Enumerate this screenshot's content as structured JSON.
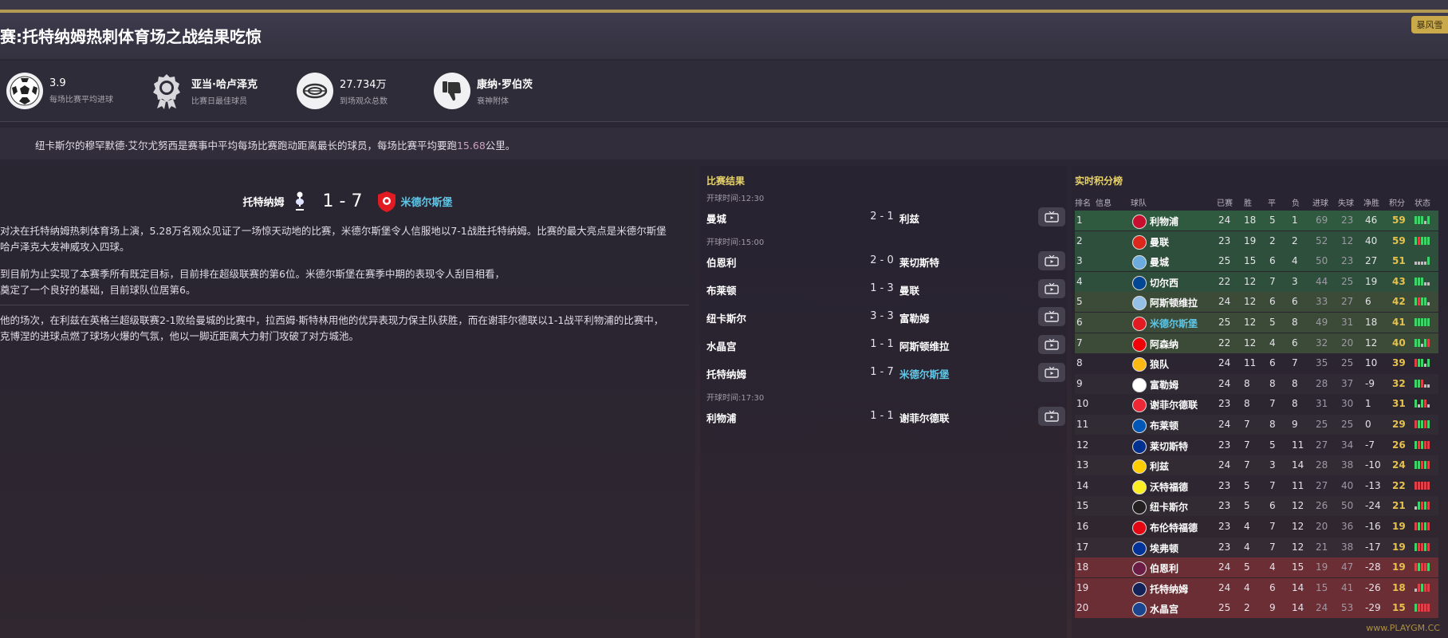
{
  "header": {
    "title": "赛:托特纳姆热刺体育场之战结果吃惊",
    "right_tag": "暴风雪"
  },
  "stats": [
    {
      "icon": "football-icon",
      "value": "3.9",
      "label": "每场比赛平均进球"
    },
    {
      "icon": "medal-icon",
      "value": "亚当·哈卢泽克",
      "label": "比赛日最佳球员"
    },
    {
      "icon": "stadium-icon",
      "value": "27.734万",
      "label": "到场观众总数"
    },
    {
      "icon": "thumbs-down-icon",
      "value": "康纳·罗伯茨",
      "label": "衰神附体"
    }
  ],
  "notice": {
    "before": "纽卡斯尔的穆罕默德·艾尔尤努西是赛事中平均每场比赛跑动距离最长的球员，每场比赛平均要跑",
    "highlight": "15.68",
    "after": "公里。"
  },
  "featured": {
    "home": "托特纳姆",
    "score": "1 - 7",
    "away": "米德尔斯堡",
    "paragraphs": [
      {
        "line1": "对决在托特纳姆热刺体育场上演，5.28万名观众见证了一场惊天动地的比赛，米德尔斯堡令人信服地以7-1战胜托特纳姆。比赛的最大亮点是米德尔斯堡",
        "line2": "哈卢泽克大发神威攻入四球。"
      },
      {
        "line1": "到目前为止实现了本赛季所有既定目标，目前排在超级联赛的第6位。米德尔斯堡在赛季中期的表现令人刮目相看，",
        "line2": "奠定了一个良好的基础，目前球队位居第6。"
      },
      {
        "line1": "他的场次，在利兹在英格兰超级联赛2-1败给曼城的比赛中，拉西姆·斯特林用他的优异表现力保主队获胜，而在谢菲尔德联以1-1战平利物浦的比赛中，",
        "line2": "克博涅的进球点燃了球场火爆的气氛，他以一脚近距离大力射门攻破了对方城池。"
      }
    ]
  },
  "results": {
    "title": "比赛结果",
    "groups": [
      {
        "time": "开球时间:12:30",
        "matches": [
          {
            "home": "曼城",
            "score": "2 - 1",
            "away": "利兹",
            "away_hi": false
          }
        ]
      },
      {
        "time": "开球时间:15:00",
        "matches": [
          {
            "home": "伯恩利",
            "score": "2 - 0",
            "away": "莱切斯特",
            "away_hi": false
          },
          {
            "home": "布莱顿",
            "score": "1 - 3",
            "away": "曼联",
            "away_hi": false
          },
          {
            "home": "纽卡斯尔",
            "score": "3 - 3",
            "away": "富勒姆",
            "away_hi": false
          },
          {
            "home": "水晶宫",
            "score": "1 - 1",
            "away": "阿斯顿维拉",
            "away_hi": false
          },
          {
            "home": "托特纳姆",
            "score": "1 - 7",
            "away": "米德尔斯堡",
            "away_hi": true
          }
        ]
      },
      {
        "time": "开球时间:17:30",
        "matches": [
          {
            "home": "利物浦",
            "score": "1 - 1",
            "away": "谢菲尔德联",
            "away_hi": false
          }
        ]
      }
    ]
  },
  "table": {
    "title": "实时积分榜",
    "headers": {
      "rank": "排名",
      "info": "信息",
      "team": "球队",
      "played": "已赛",
      "won": "胜",
      "drawn": "平",
      "lost": "负",
      "gf": "进球",
      "ga": "失球",
      "gd": "净胜",
      "pts": "积分",
      "form": "状态"
    },
    "rows": [
      {
        "rank": "1",
        "team": "利物浦",
        "p": "24",
        "w": "18",
        "d": "5",
        "l": "1",
        "gf": "69",
        "ga": "23",
        "gd": "46",
        "pts": "59",
        "crest": "#c8102e",
        "zone": "#2f5a3f",
        "form": [
          "W",
          "W",
          "W",
          "D",
          "W"
        ],
        "hi": false
      },
      {
        "rank": "2",
        "team": "曼联",
        "p": "23",
        "w": "19",
        "d": "2",
        "l": "2",
        "gf": "52",
        "ga": "12",
        "gd": "40",
        "pts": "59",
        "crest": "#da291c",
        "zone": "#2f4f3d",
        "form": [
          "W",
          "L",
          "W",
          "W",
          "W"
        ],
        "hi": false
      },
      {
        "rank": "3",
        "team": "曼城",
        "p": "25",
        "w": "15",
        "d": "6",
        "l": "4",
        "gf": "50",
        "ga": "23",
        "gd": "27",
        "pts": "51",
        "crest": "#6cabdd",
        "zone": "#2f4f3d",
        "form": [
          "D",
          "D",
          "D",
          "D",
          "W"
        ],
        "hi": false
      },
      {
        "rank": "4",
        "team": "切尔西",
        "p": "22",
        "w": "12",
        "d": "7",
        "l": "3",
        "gf": "44",
        "ga": "25",
        "gd": "19",
        "pts": "43",
        "crest": "#034694",
        "zone": "#2f4f3d",
        "form": [
          "W",
          "W",
          "W",
          "D",
          "D"
        ],
        "hi": false
      },
      {
        "rank": "5",
        "team": "阿斯顿维拉",
        "p": "24",
        "w": "12",
        "d": "6",
        "l": "6",
        "gf": "33",
        "ga": "27",
        "gd": "6",
        "pts": "42",
        "crest": "#95bfe5",
        "zone": "#3c4a38",
        "form": [
          "W",
          "L",
          "W",
          "W",
          "D"
        ],
        "hi": false
      },
      {
        "rank": "6",
        "team": "米德尔斯堡",
        "p": "25",
        "w": "12",
        "d": "5",
        "l": "8",
        "gf": "49",
        "ga": "31",
        "gd": "18",
        "pts": "41",
        "crest": "#e21b23",
        "zone": "#3c4a38",
        "form": [
          "W",
          "W",
          "W",
          "W",
          "W"
        ],
        "hi": true
      },
      {
        "rank": "7",
        "team": "阿森纳",
        "p": "22",
        "w": "12",
        "d": "4",
        "l": "6",
        "gf": "32",
        "ga": "20",
        "gd": "12",
        "pts": "40",
        "crest": "#ef0107",
        "zone": "#3c4a38",
        "form": [
          "W",
          "W",
          "D",
          "W",
          "L"
        ],
        "hi": false
      },
      {
        "rank": "8",
        "team": "狼队",
        "p": "24",
        "w": "11",
        "d": "6",
        "l": "7",
        "gf": "35",
        "ga": "25",
        "gd": "10",
        "pts": "39",
        "crest": "#fdb913",
        "zone": "none",
        "form": [
          "L",
          "W",
          "W",
          "D",
          "W"
        ],
        "hi": false
      },
      {
        "rank": "9",
        "team": "富勒姆",
        "p": "24",
        "w": "8",
        "d": "8",
        "l": "8",
        "gf": "28",
        "ga": "37",
        "gd": "-9",
        "pts": "32",
        "crest": "#ffffff",
        "zone": "none",
        "form": [
          "W",
          "W",
          "L",
          "D",
          "D"
        ],
        "hi": false
      },
      {
        "rank": "10",
        "team": "谢菲尔德联",
        "p": "23",
        "w": "8",
        "d": "7",
        "l": "8",
        "gf": "31",
        "ga": "30",
        "gd": "1",
        "pts": "31",
        "crest": "#ee2737",
        "zone": "none",
        "form": [
          "W",
          "D",
          "W",
          "L",
          "D"
        ],
        "hi": false
      },
      {
        "rank": "11",
        "team": "布莱顿",
        "p": "24",
        "w": "7",
        "d": "8",
        "l": "9",
        "gf": "25",
        "ga": "25",
        "gd": "0",
        "pts": "29",
        "crest": "#0057b8",
        "zone": "none",
        "form": [
          "L",
          "W",
          "W",
          "L",
          "W"
        ],
        "hi": false
      },
      {
        "rank": "12",
        "team": "莱切斯特",
        "p": "23",
        "w": "7",
        "d": "5",
        "l": "11",
        "gf": "27",
        "ga": "34",
        "gd": "-7",
        "pts": "26",
        "crest": "#003090",
        "zone": "none",
        "form": [
          "W",
          "L",
          "W",
          "L",
          "L"
        ],
        "hi": false
      },
      {
        "rank": "13",
        "team": "利兹",
        "p": "24",
        "w": "7",
        "d": "3",
        "l": "14",
        "gf": "28",
        "ga": "38",
        "gd": "-10",
        "pts": "24",
        "crest": "#ffcd00",
        "zone": "none",
        "form": [
          "W",
          "W",
          "L",
          "W",
          "L"
        ],
        "hi": false
      },
      {
        "rank": "14",
        "team": "沃特福德",
        "p": "23",
        "w": "5",
        "d": "7",
        "l": "11",
        "gf": "27",
        "ga": "40",
        "gd": "-13",
        "pts": "22",
        "crest": "#fbee23",
        "zone": "none",
        "form": [
          "L",
          "L",
          "L",
          "L",
          "L"
        ],
        "hi": false
      },
      {
        "rank": "15",
        "team": "纽卡斯尔",
        "p": "23",
        "w": "5",
        "d": "6",
        "l": "12",
        "gf": "26",
        "ga": "50",
        "gd": "-24",
        "pts": "21",
        "crest": "#241f20",
        "zone": "none",
        "form": [
          "D",
          "W",
          "L",
          "W",
          "L"
        ],
        "hi": false
      },
      {
        "rank": "16",
        "team": "布伦特福德",
        "p": "23",
        "w": "4",
        "d": "7",
        "l": "12",
        "gf": "20",
        "ga": "36",
        "gd": "-16",
        "pts": "19",
        "crest": "#e30613",
        "zone": "none",
        "form": [
          "L",
          "W",
          "L",
          "W",
          "L"
        ],
        "hi": false
      },
      {
        "rank": "17",
        "team": "埃弗顿",
        "p": "23",
        "w": "4",
        "d": "7",
        "l": "12",
        "gf": "21",
        "ga": "38",
        "gd": "-17",
        "pts": "19",
        "crest": "#003399",
        "zone": "none",
        "form": [
          "W",
          "L",
          "L",
          "W",
          "L"
        ],
        "hi": false
      },
      {
        "rank": "18",
        "team": "伯恩利",
        "p": "24",
        "w": "5",
        "d": "4",
        "l": "15",
        "gf": "19",
        "ga": "47",
        "gd": "-28",
        "pts": "19",
        "crest": "#6c1d45",
        "zone": "#6a2e34",
        "form": [
          "L",
          "W",
          "L",
          "L",
          "W"
        ],
        "hi": false
      },
      {
        "rank": "19",
        "team": "托特纳姆",
        "p": "24",
        "w": "4",
        "d": "6",
        "l": "14",
        "gf": "15",
        "ga": "41",
        "gd": "-26",
        "pts": "18",
        "crest": "#132257",
        "zone": "#6a2e34",
        "form": [
          "D",
          "L",
          "W",
          "L",
          "L"
        ],
        "hi": false
      },
      {
        "rank": "20",
        "team": "水晶宫",
        "p": "25",
        "w": "2",
        "d": "9",
        "l": "14",
        "gf": "24",
        "ga": "53",
        "gd": "-29",
        "pts": "15",
        "crest": "#1b458f",
        "zone": "#6a2e34",
        "form": [
          "W",
          "L",
          "L",
          "L",
          "L"
        ],
        "hi": false
      }
    ]
  },
  "watermark": "www.PLAYGM.CC",
  "colors": {
    "gold": "#b39a52",
    "highlight_team": "#5ec7e8",
    "points": "#e6c24c",
    "section_title": "#e8d36a",
    "form_win": "#3fd36b",
    "form_loss": "#e0404a",
    "form_draw": "#bfbfbf"
  }
}
